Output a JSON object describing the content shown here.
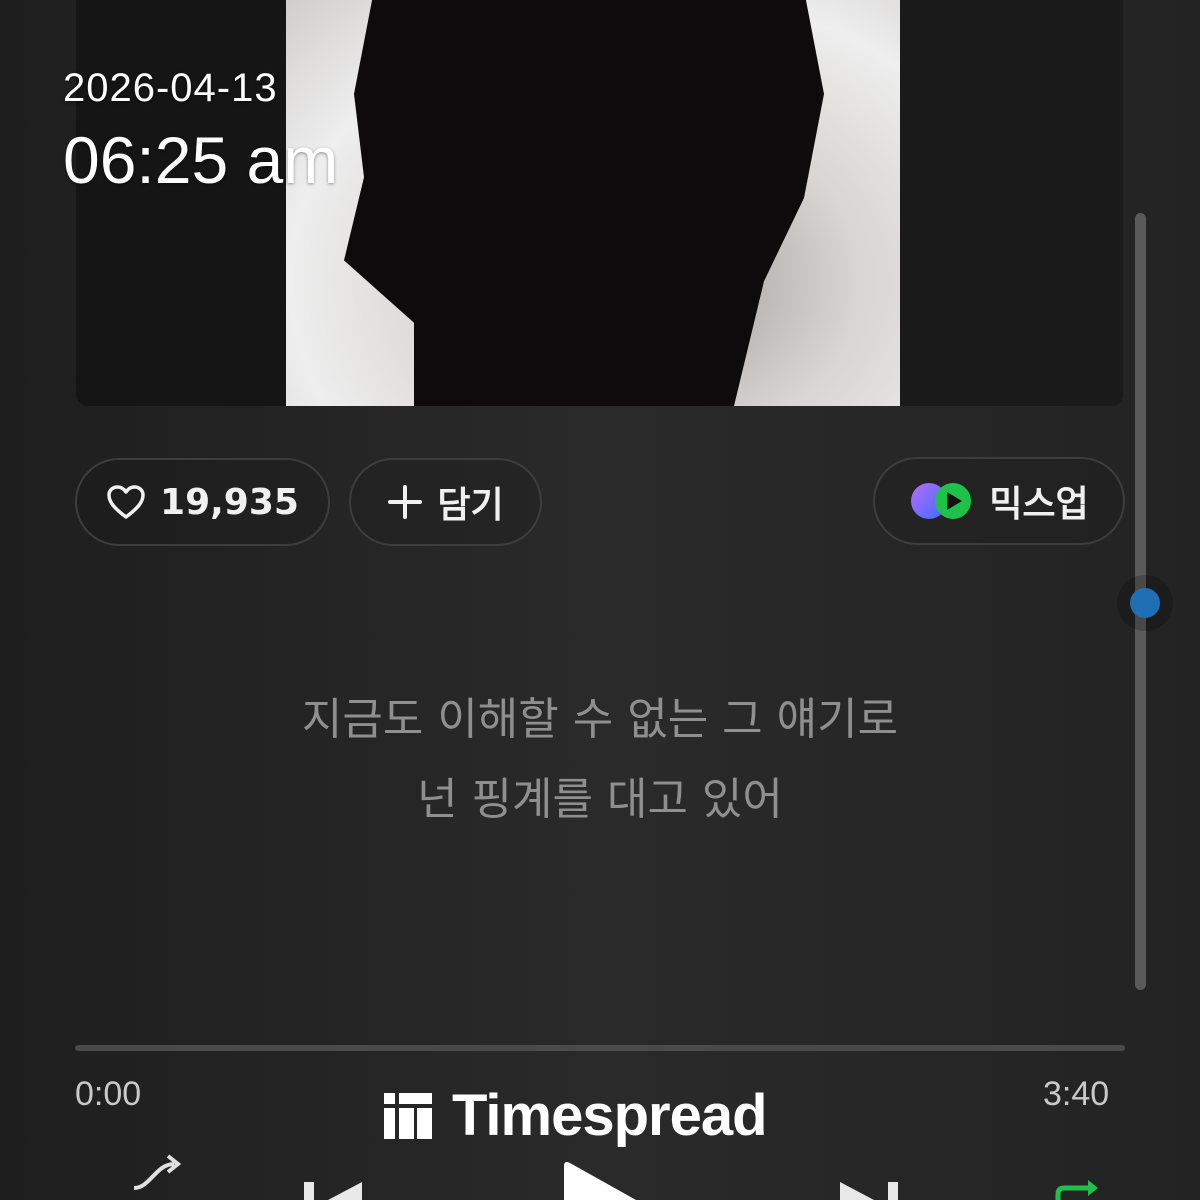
{
  "overlay": {
    "date": "2026-04-13",
    "time": "06:25 am"
  },
  "actions": {
    "like_count": "19,935",
    "add_label": "담기",
    "mixup_label": "믹스업"
  },
  "lyrics": {
    "line1": "지금도 이해할 수 없는 그 얘기로",
    "line2": "넌 핑계를 대고 있어"
  },
  "player": {
    "elapsed": "0:00",
    "duration": "3:40",
    "progress_fraction": 0.0
  },
  "watermark": {
    "text": "Timespread"
  },
  "colors": {
    "background": "#262626",
    "accent_blue": "#1e6fb3",
    "repeat_green": "#1ec24a",
    "mixup_purple": "#8b5cf6"
  },
  "icons": {
    "like": "heart-icon",
    "add": "plus-icon",
    "mixup": "mixup-logo-icon",
    "watermark": "timespread-logo-icon",
    "controls": [
      "shuffle-icon",
      "previous-icon",
      "play-icon",
      "next-icon",
      "repeat-icon"
    ]
  }
}
